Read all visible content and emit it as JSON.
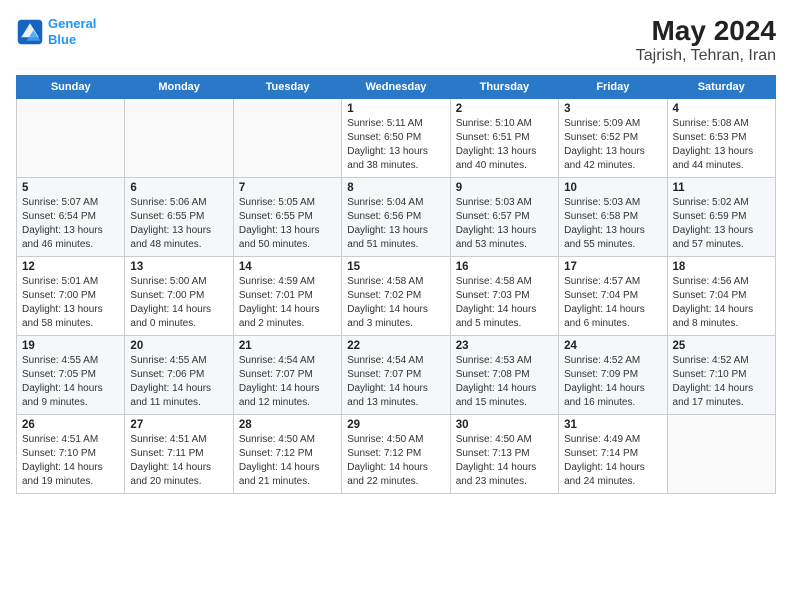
{
  "header": {
    "logo_line1": "General",
    "logo_line2": "Blue",
    "title": "May 2024",
    "subtitle": "Tajrish, Tehran, Iran"
  },
  "weekdays": [
    "Sunday",
    "Monday",
    "Tuesday",
    "Wednesday",
    "Thursday",
    "Friday",
    "Saturday"
  ],
  "weeks": [
    [
      {
        "day": "",
        "info": ""
      },
      {
        "day": "",
        "info": ""
      },
      {
        "day": "",
        "info": ""
      },
      {
        "day": "1",
        "info": "Sunrise: 5:11 AM\nSunset: 6:50 PM\nDaylight: 13 hours\nand 38 minutes."
      },
      {
        "day": "2",
        "info": "Sunrise: 5:10 AM\nSunset: 6:51 PM\nDaylight: 13 hours\nand 40 minutes."
      },
      {
        "day": "3",
        "info": "Sunrise: 5:09 AM\nSunset: 6:52 PM\nDaylight: 13 hours\nand 42 minutes."
      },
      {
        "day": "4",
        "info": "Sunrise: 5:08 AM\nSunset: 6:53 PM\nDaylight: 13 hours\nand 44 minutes."
      }
    ],
    [
      {
        "day": "5",
        "info": "Sunrise: 5:07 AM\nSunset: 6:54 PM\nDaylight: 13 hours\nand 46 minutes."
      },
      {
        "day": "6",
        "info": "Sunrise: 5:06 AM\nSunset: 6:55 PM\nDaylight: 13 hours\nand 48 minutes."
      },
      {
        "day": "7",
        "info": "Sunrise: 5:05 AM\nSunset: 6:55 PM\nDaylight: 13 hours\nand 50 minutes."
      },
      {
        "day": "8",
        "info": "Sunrise: 5:04 AM\nSunset: 6:56 PM\nDaylight: 13 hours\nand 51 minutes."
      },
      {
        "day": "9",
        "info": "Sunrise: 5:03 AM\nSunset: 6:57 PM\nDaylight: 13 hours\nand 53 minutes."
      },
      {
        "day": "10",
        "info": "Sunrise: 5:03 AM\nSunset: 6:58 PM\nDaylight: 13 hours\nand 55 minutes."
      },
      {
        "day": "11",
        "info": "Sunrise: 5:02 AM\nSunset: 6:59 PM\nDaylight: 13 hours\nand 57 minutes."
      }
    ],
    [
      {
        "day": "12",
        "info": "Sunrise: 5:01 AM\nSunset: 7:00 PM\nDaylight: 13 hours\nand 58 minutes."
      },
      {
        "day": "13",
        "info": "Sunrise: 5:00 AM\nSunset: 7:00 PM\nDaylight: 14 hours\nand 0 minutes."
      },
      {
        "day": "14",
        "info": "Sunrise: 4:59 AM\nSunset: 7:01 PM\nDaylight: 14 hours\nand 2 minutes."
      },
      {
        "day": "15",
        "info": "Sunrise: 4:58 AM\nSunset: 7:02 PM\nDaylight: 14 hours\nand 3 minutes."
      },
      {
        "day": "16",
        "info": "Sunrise: 4:58 AM\nSunset: 7:03 PM\nDaylight: 14 hours\nand 5 minutes."
      },
      {
        "day": "17",
        "info": "Sunrise: 4:57 AM\nSunset: 7:04 PM\nDaylight: 14 hours\nand 6 minutes."
      },
      {
        "day": "18",
        "info": "Sunrise: 4:56 AM\nSunset: 7:04 PM\nDaylight: 14 hours\nand 8 minutes."
      }
    ],
    [
      {
        "day": "19",
        "info": "Sunrise: 4:55 AM\nSunset: 7:05 PM\nDaylight: 14 hours\nand 9 minutes."
      },
      {
        "day": "20",
        "info": "Sunrise: 4:55 AM\nSunset: 7:06 PM\nDaylight: 14 hours\nand 11 minutes."
      },
      {
        "day": "21",
        "info": "Sunrise: 4:54 AM\nSunset: 7:07 PM\nDaylight: 14 hours\nand 12 minutes."
      },
      {
        "day": "22",
        "info": "Sunrise: 4:54 AM\nSunset: 7:07 PM\nDaylight: 14 hours\nand 13 minutes."
      },
      {
        "day": "23",
        "info": "Sunrise: 4:53 AM\nSunset: 7:08 PM\nDaylight: 14 hours\nand 15 minutes."
      },
      {
        "day": "24",
        "info": "Sunrise: 4:52 AM\nSunset: 7:09 PM\nDaylight: 14 hours\nand 16 minutes."
      },
      {
        "day": "25",
        "info": "Sunrise: 4:52 AM\nSunset: 7:10 PM\nDaylight: 14 hours\nand 17 minutes."
      }
    ],
    [
      {
        "day": "26",
        "info": "Sunrise: 4:51 AM\nSunset: 7:10 PM\nDaylight: 14 hours\nand 19 minutes."
      },
      {
        "day": "27",
        "info": "Sunrise: 4:51 AM\nSunset: 7:11 PM\nDaylight: 14 hours\nand 20 minutes."
      },
      {
        "day": "28",
        "info": "Sunrise: 4:50 AM\nSunset: 7:12 PM\nDaylight: 14 hours\nand 21 minutes."
      },
      {
        "day": "29",
        "info": "Sunrise: 4:50 AM\nSunset: 7:12 PM\nDaylight: 14 hours\nand 22 minutes."
      },
      {
        "day": "30",
        "info": "Sunrise: 4:50 AM\nSunset: 7:13 PM\nDaylight: 14 hours\nand 23 minutes."
      },
      {
        "day": "31",
        "info": "Sunrise: 4:49 AM\nSunset: 7:14 PM\nDaylight: 14 hours\nand 24 minutes."
      },
      {
        "day": "",
        "info": ""
      }
    ]
  ]
}
